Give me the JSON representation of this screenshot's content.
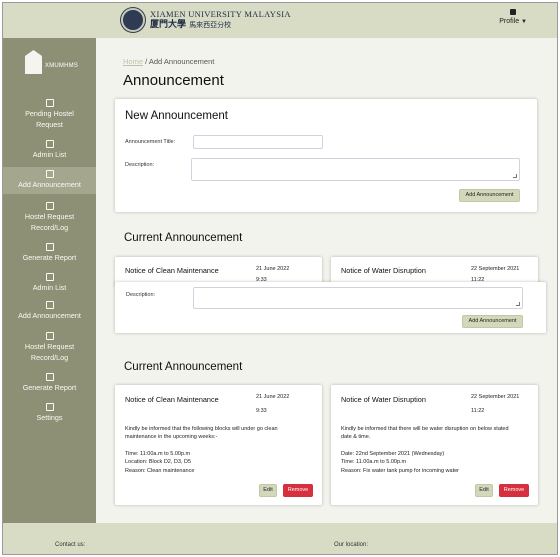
{
  "header": {
    "university_en": "XIAMEN UNIVERSITY MALAYSIA",
    "university_zh": "厦門大學",
    "university_zh_sub": "馬來西亞分校",
    "profile_label": "Profile"
  },
  "sidebar": {
    "logo_text": "XMUMHMS",
    "items": [
      {
        "label": "Pending Hostel Request",
        "icon": "inbox-icon"
      },
      {
        "label": "Admin List",
        "icon": "user-icon"
      },
      {
        "label": "Add Announcement",
        "icon": "envelope-icon"
      },
      {
        "label": "Hostel Request Record/Log",
        "icon": "file-icon"
      },
      {
        "label": "Generate Report",
        "icon": "report-icon"
      },
      {
        "label": "Admin List",
        "icon": "users-icon"
      },
      {
        "label": "Add Announcement",
        "icon": "envelope-icon"
      },
      {
        "label": "Hostel Request Record/Log",
        "icon": "file-icon"
      },
      {
        "label": "Generate Report",
        "icon": "report-icon"
      },
      {
        "label": "Settings",
        "icon": "sliders-icon"
      }
    ]
  },
  "breadcrumb": {
    "home": "Home",
    "separator": "/",
    "current": "Add Announcement"
  },
  "page_title": "Announcement",
  "new_announcement": {
    "title": "New Announcement",
    "title_label": "Announcement Title:",
    "title_value": "",
    "description_label": "Description:",
    "description_value": "",
    "submit_label": "Add Announcement"
  },
  "overlap_form": {
    "description_label": "Description:",
    "submit_label": "Add Announcement"
  },
  "current_section_1": {
    "title": "Current Announcement",
    "cards": [
      {
        "title": "Notice of Clean Maintenance",
        "date": "21 June 2022",
        "time": "9:33"
      },
      {
        "title": "Notice of Water Disruption",
        "date": "22 September 2021",
        "time": "11:22"
      }
    ]
  },
  "current_section_2": {
    "title": "Current Announcement",
    "cards": [
      {
        "title": "Notice of Clean Maintenance",
        "date": "21 June 2022",
        "time": "9:33",
        "body": [
          "Kindly be informed that the following blocks will under go clean",
          "maintenance in the upcoming weeks:-",
          "",
          "Time: 11:00a.m to 5.00p.m",
          "Location: Block D2, D3, D5",
          "Reason: Clean maintenance"
        ],
        "edit_label": "Edit",
        "remove_label": "Remove"
      },
      {
        "title": "Notice of Water Disruption",
        "date": "22 September 2021",
        "time": "11:22",
        "body": [
          "Kindly be informed that there will be water disruption on below stated",
          "date & time.",
          "",
          "Date: 22nd September 2021 (Wednesday)",
          "Time: 11.00a.m to 5.00p.m",
          "Reason: Fix water tank pump for incoming water"
        ],
        "edit_label": "Edit",
        "remove_label": "Remove"
      }
    ]
  },
  "footer": {
    "contact": "Contact us:",
    "location": "Our location:"
  },
  "colors": {
    "olive_dark": "#8d9075",
    "olive_light": "#d8dcc5",
    "button_olive": "#d4d8bb",
    "danger": "#d62f3e"
  }
}
